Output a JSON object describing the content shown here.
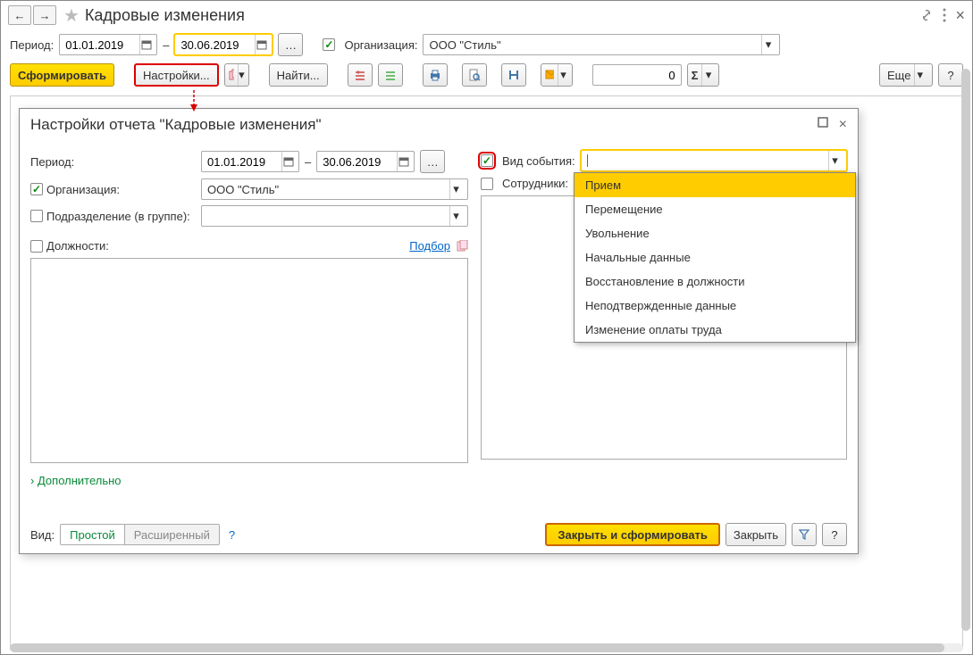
{
  "header": {
    "title": "Кадровые изменения"
  },
  "period": {
    "label": "Период:",
    "from": "01.01.2019",
    "separator": "–",
    "to": "30.06.2019"
  },
  "org": {
    "label": "Организация:",
    "value": "ООО \"Стиль\""
  },
  "toolbar": {
    "generate": "Сформировать",
    "settings": "Настройки...",
    "find": "Найти...",
    "sum_value": "0",
    "more": "Еще",
    "help": "?"
  },
  "dialog": {
    "title": "Настройки отчета \"Кадровые изменения\"",
    "period_label": "Период:",
    "period_from": "01.01.2019",
    "period_separator": "–",
    "period_to": "30.06.2019",
    "org_label": "Организация:",
    "org_value": "ООО \"Стиль\"",
    "subdiv_label": "Подразделение (в группе):",
    "positions_label": "Должности:",
    "pick_link": "Подбор",
    "event_label": "Вид события:",
    "employees_label": "Сотрудники:",
    "additional": "Дополнительно",
    "view_label": "Вид:",
    "view_simple": "Простой",
    "view_advanced": "Расширенный",
    "help": "?",
    "close_generate": "Закрыть и сформировать",
    "close": "Закрыть"
  },
  "event_options": [
    "Прием",
    "Перемещение",
    "Увольнение",
    "Начальные данные",
    "Восстановление в должности",
    "Неподтвержденные данные",
    "Изменение оплаты труда"
  ]
}
